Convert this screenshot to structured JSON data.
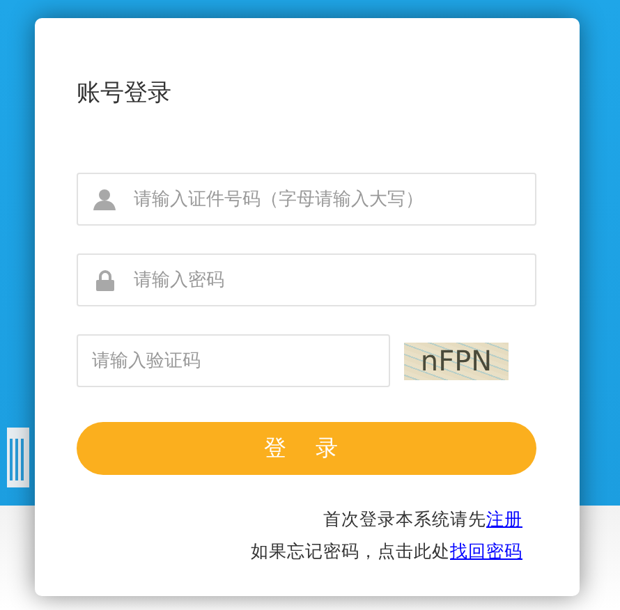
{
  "title": "账号登录",
  "fields": [
    {
      "kind": "user",
      "placeholder": "请输入证件号码（字母请输入大写）"
    },
    {
      "kind": "password",
      "placeholder": "请输入密码"
    }
  ],
  "captcha": {
    "placeholder": "请输入验证码",
    "code": "nFPN"
  },
  "login_button": "登 录",
  "links": [
    {
      "text": "首次登录本系统请先",
      "link": "注册"
    },
    {
      "text": "如果忘记密码，点击此处",
      "link": "找回密码"
    }
  ]
}
